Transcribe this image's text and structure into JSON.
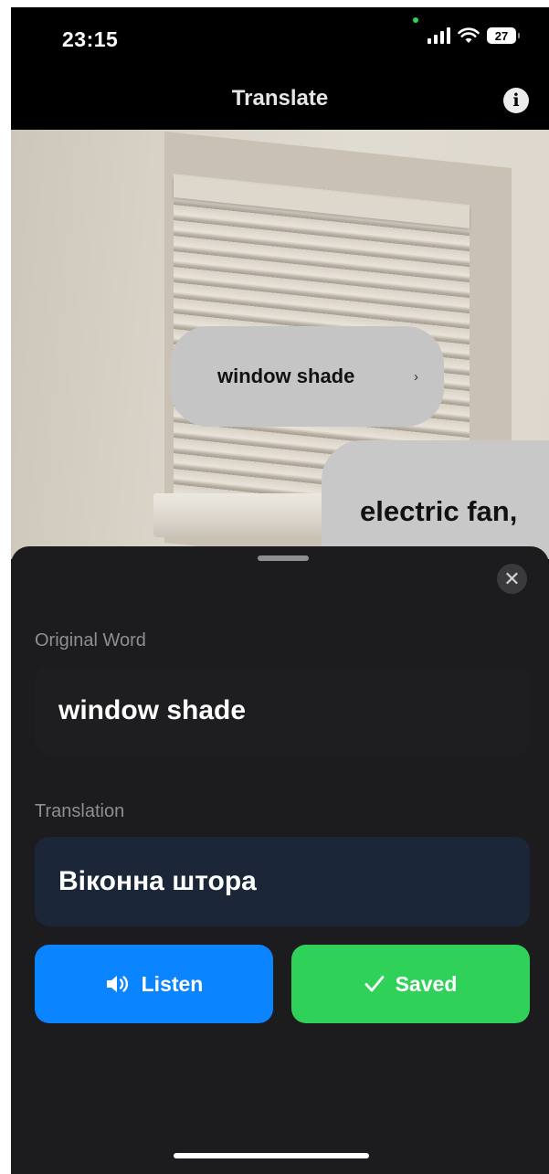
{
  "status_bar": {
    "time": "23:15",
    "battery": "27"
  },
  "nav": {
    "title": "Translate"
  },
  "camera": {
    "labels": [
      {
        "text": "window shade",
        "chevron": "›"
      },
      {
        "text": "electric fan,"
      }
    ]
  },
  "sheet": {
    "original_label": "Original Word",
    "original_value": "window shade",
    "translation_label": "Translation",
    "translation_value": "Віконна штора",
    "listen_label": "Listen",
    "saved_label": "Saved"
  },
  "icons": {
    "info": "info-icon",
    "close": "close-icon",
    "speaker": "speaker-icon",
    "check": "checkmark-icon"
  },
  "colors": {
    "listen": "#0a84ff",
    "saved": "#30d158",
    "sheet_background": "#1c1c1e"
  }
}
